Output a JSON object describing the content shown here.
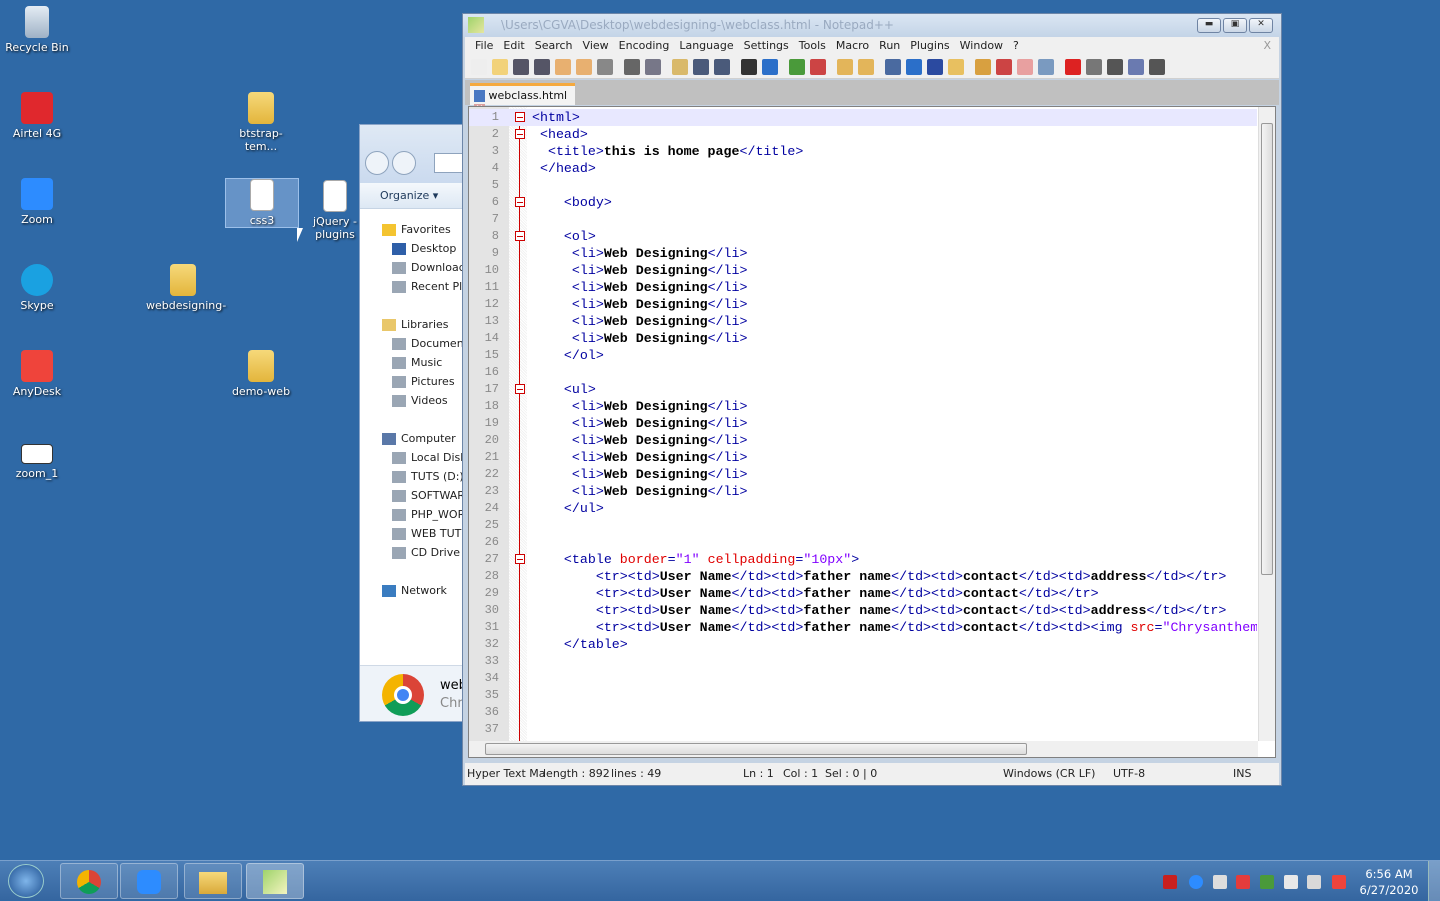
{
  "desktop": {
    "icons": [
      {
        "label": "Recycle Bin",
        "icon": "recycle-bin-icon"
      },
      {
        "label": "Airtel 4G",
        "icon": "airtel-icon"
      },
      {
        "label": "Zoom",
        "icon": "zoom-icon"
      },
      {
        "label": "Skype",
        "icon": "skype-icon"
      },
      {
        "label": "AnyDesk",
        "icon": "anydesk-icon"
      },
      {
        "label": "zoom_1",
        "icon": "file-icon"
      },
      {
        "label": "btstrap-tem...",
        "icon": "folder-icon"
      },
      {
        "label": "css3",
        "icon": "file-icon"
      },
      {
        "label": "jQuery - plugins",
        "icon": "file-icon"
      },
      {
        "label": "webdesigning-",
        "icon": "folder-icon"
      },
      {
        "label": "demo-web",
        "icon": "folder-icon"
      }
    ]
  },
  "explorer": {
    "organize": "Organize ▾",
    "nav": [
      {
        "label": "Favorites",
        "group": true
      },
      {
        "label": "Desktop"
      },
      {
        "label": "Downloads"
      },
      {
        "label": "Recent Places"
      },
      {
        "label": "Libraries",
        "group": true
      },
      {
        "label": "Documents"
      },
      {
        "label": "Music"
      },
      {
        "label": "Pictures"
      },
      {
        "label": "Videos"
      },
      {
        "label": "Computer",
        "group": true
      },
      {
        "label": "Local Disk"
      },
      {
        "label": "TUTS (D:)"
      },
      {
        "label": "SOFTWARE"
      },
      {
        "label": "PHP_WORK"
      },
      {
        "label": "WEB TUTS"
      },
      {
        "label": "CD Drive ("
      },
      {
        "label": "Network",
        "group": true
      }
    ],
    "jump_item": {
      "title": "web",
      "subtitle": "Chr"
    }
  },
  "npp": {
    "title": "\\Users\\CGVA\\Desktop\\webdesigning-\\webclass.html - Notepad++",
    "menu": [
      "File",
      "Edit",
      "Search",
      "View",
      "Encoding",
      "Language",
      "Settings",
      "Tools",
      "Macro",
      "Run",
      "Plugins",
      "Window",
      "?"
    ],
    "menu_close": "X",
    "toolbar": [
      "new",
      "open",
      "save",
      "save-all",
      "close",
      "close-all",
      "print",
      "cut",
      "copy",
      "paste",
      "undo",
      "redo",
      "find",
      "replace",
      "zoom-in",
      "zoom-out",
      "sync-v",
      "sync-h",
      "word-wrap",
      "show-all-chars",
      "indent-guide",
      "udl",
      "doc-map",
      "function-list",
      "folder-workspace",
      "monitor",
      "record-macro",
      "stop-macro",
      "play-macro",
      "run-macro-multiple",
      "save-macro"
    ],
    "tab": "webclass.html",
    "lines": [
      [
        [
          "tag",
          "<html>"
        ]
      ],
      [
        [
          "sp",
          " "
        ],
        [
          "tag",
          "<head>"
        ]
      ],
      [
        [
          "sp",
          "  "
        ],
        [
          "tag",
          "<title>"
        ],
        [
          "text",
          "this is home page"
        ],
        [
          "tag",
          "</title>"
        ]
      ],
      [
        [
          "sp",
          " "
        ],
        [
          "tag",
          "</head>"
        ]
      ],
      [],
      [
        [
          "sp",
          "    "
        ],
        [
          "tag",
          "<body>"
        ]
      ],
      [],
      [
        [
          "sp",
          "    "
        ],
        [
          "tag",
          "<ol>"
        ]
      ],
      [
        [
          "sp",
          "     "
        ],
        [
          "tag",
          "<li>"
        ],
        [
          "text",
          "Web Designing"
        ],
        [
          "tag",
          "</li>"
        ]
      ],
      [
        [
          "sp",
          "     "
        ],
        [
          "tag",
          "<li>"
        ],
        [
          "text",
          "Web Designing"
        ],
        [
          "tag",
          "</li>"
        ]
      ],
      [
        [
          "sp",
          "     "
        ],
        [
          "tag",
          "<li>"
        ],
        [
          "text",
          "Web Designing"
        ],
        [
          "tag",
          "</li>"
        ]
      ],
      [
        [
          "sp",
          "     "
        ],
        [
          "tag",
          "<li>"
        ],
        [
          "text",
          "Web Designing"
        ],
        [
          "tag",
          "</li>"
        ]
      ],
      [
        [
          "sp",
          "     "
        ],
        [
          "tag",
          "<li>"
        ],
        [
          "text",
          "Web Designing"
        ],
        [
          "tag",
          "</li>"
        ]
      ],
      [
        [
          "sp",
          "     "
        ],
        [
          "tag",
          "<li>"
        ],
        [
          "text",
          "Web Designing"
        ],
        [
          "tag",
          "</li>"
        ]
      ],
      [
        [
          "sp",
          "    "
        ],
        [
          "tag",
          "</ol>"
        ]
      ],
      [],
      [
        [
          "sp",
          "    "
        ],
        [
          "tag",
          "<ul>"
        ]
      ],
      [
        [
          "sp",
          "     "
        ],
        [
          "tag",
          "<li>"
        ],
        [
          "text",
          "Web Designing"
        ],
        [
          "tag",
          "</li>"
        ]
      ],
      [
        [
          "sp",
          "     "
        ],
        [
          "tag",
          "<li>"
        ],
        [
          "text",
          "Web Designing"
        ],
        [
          "tag",
          "</li>"
        ]
      ],
      [
        [
          "sp",
          "     "
        ],
        [
          "tag",
          "<li>"
        ],
        [
          "text",
          "Web Designing"
        ],
        [
          "tag",
          "</li>"
        ]
      ],
      [
        [
          "sp",
          "     "
        ],
        [
          "tag",
          "<li>"
        ],
        [
          "text",
          "Web Designing"
        ],
        [
          "tag",
          "</li>"
        ]
      ],
      [
        [
          "sp",
          "     "
        ],
        [
          "tag",
          "<li>"
        ],
        [
          "text",
          "Web Designing"
        ],
        [
          "tag",
          "</li>"
        ]
      ],
      [
        [
          "sp",
          "     "
        ],
        [
          "tag",
          "<li>"
        ],
        [
          "text",
          "Web Designing"
        ],
        [
          "tag",
          "</li>"
        ]
      ],
      [
        [
          "sp",
          "    "
        ],
        [
          "tag",
          "</ul>"
        ]
      ],
      [],
      [],
      [
        [
          "sp",
          "    "
        ],
        [
          "tag",
          "<table "
        ],
        [
          "attr",
          "border"
        ],
        [
          "tag",
          "="
        ],
        [
          "val",
          "\"1\""
        ],
        [
          "tag",
          " "
        ],
        [
          "attr",
          "cellpadding"
        ],
        [
          "tag",
          "="
        ],
        [
          "val",
          "\"10px\""
        ],
        [
          "tag",
          ">"
        ]
      ],
      [
        [
          "sp",
          "        "
        ],
        [
          "tag",
          "<tr><td>"
        ],
        [
          "text",
          "User Name"
        ],
        [
          "tag",
          "</td><td>"
        ],
        [
          "text",
          "father name"
        ],
        [
          "tag",
          "</td><td>"
        ],
        [
          "text",
          "contact"
        ],
        [
          "tag",
          "</td><td>"
        ],
        [
          "text",
          "address"
        ],
        [
          "tag",
          "</td></tr>"
        ]
      ],
      [
        [
          "sp",
          "        "
        ],
        [
          "tag",
          "<tr><td>"
        ],
        [
          "text",
          "User Name"
        ],
        [
          "tag",
          "</td><td>"
        ],
        [
          "text",
          "father name"
        ],
        [
          "tag",
          "</td><td>"
        ],
        [
          "text",
          "contact"
        ],
        [
          "tag",
          "</td></tr>"
        ]
      ],
      [
        [
          "sp",
          "        "
        ],
        [
          "tag",
          "<tr><td>"
        ],
        [
          "text",
          "User Name"
        ],
        [
          "tag",
          "</td><td>"
        ],
        [
          "text",
          "father name"
        ],
        [
          "tag",
          "</td><td>"
        ],
        [
          "text",
          "contact"
        ],
        [
          "tag",
          "</td><td>"
        ],
        [
          "text",
          "address"
        ],
        [
          "tag",
          "</td></tr>"
        ]
      ],
      [
        [
          "sp",
          "        "
        ],
        [
          "tag",
          "<tr><td>"
        ],
        [
          "text",
          "User Name"
        ],
        [
          "tag",
          "</td><td>"
        ],
        [
          "text",
          "father name"
        ],
        [
          "tag",
          "</td><td>"
        ],
        [
          "text",
          "contact"
        ],
        [
          "tag",
          "</td><td><img "
        ],
        [
          "attr",
          "src"
        ],
        [
          "tag",
          "="
        ],
        [
          "val",
          "\"Chrysanthem"
        ]
      ],
      [
        [
          "sp",
          "    "
        ],
        [
          "tag",
          "</table>"
        ]
      ],
      [],
      [],
      [],
      [],
      []
    ],
    "fold_lines": [
      1,
      2,
      6,
      8,
      17,
      27
    ],
    "status": {
      "type": "Hyper Text Ma",
      "length": "length : 892",
      "lines": "lines : 49",
      "ln": "Ln : 1",
      "col": "Col : 1",
      "sel": "Sel : 0 | 0",
      "eol": "Windows (CR LF)",
      "encoding": "UTF-8",
      "mode": "INS"
    }
  },
  "taskbar": {
    "apps": [
      "chrome-icon",
      "zoom-icon",
      "explorer-icon",
      "notepadpp-icon"
    ],
    "tray": [
      "adobe-icon",
      "zoom-tray-icon",
      "action-center-icon",
      "airtel-tray-icon",
      "safely-remove-icon",
      "network-icon",
      "volume-icon",
      "anydesk-tray-icon"
    ],
    "time": "6:56 AM",
    "date": "6/27/2020"
  }
}
